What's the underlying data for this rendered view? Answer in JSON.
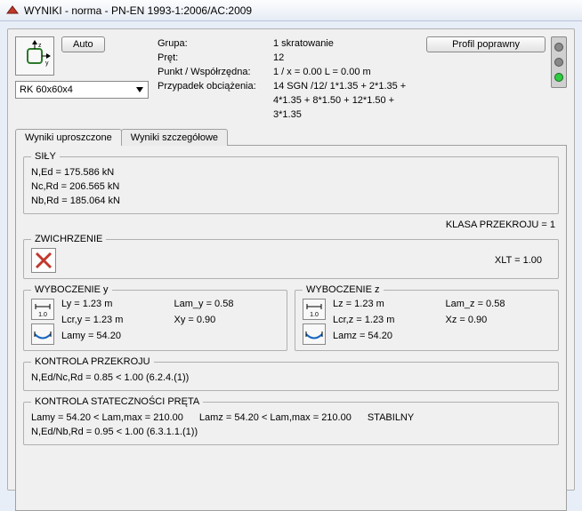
{
  "window": {
    "title": "WYNIKI - norma - PN-EN 1993-1:2006/AC:2009"
  },
  "top": {
    "auto_label": "Auto",
    "combo_value": "RK 60x60x4",
    "info": {
      "grupa_label": "Grupa:",
      "grupa_value": "1   skratowanie",
      "pret_label": "Pręt:",
      "pret_value": "12",
      "punkt_label": "Punkt / Współrzędna:",
      "punkt_value": "1 / x = 0.00 L = 0.00 m",
      "przypadek_label": "Przypadek obciążenia:",
      "przypadek_value": "14 SGN /12/  1*1.35 + 2*1.35 + 4*1.35 + 8*1.50 + 12*1.50 + 3*1.35"
    },
    "profile_status_label": "Profil poprawny"
  },
  "tabs": {
    "tab1": "Wyniki uproszczone",
    "tab2": "Wyniki szczegółowe"
  },
  "sily": {
    "legend": "SIŁY",
    "l1": "N,Ed = 175.586 kN",
    "l2": "Nc,Rd = 206.565 kN",
    "l3": "Nb,Rd = 185.064 kN"
  },
  "klasa": "KLASA PRZEKROJU = 1",
  "zwich": {
    "legend": "ZWICHRZENIE",
    "xlt": "XLT = 1.00"
  },
  "wyb_y": {
    "legend": "WYBOCZENIE  y",
    "ly": "Ly = 1.23 m",
    "lamy": "Lam_y = 0.58",
    "lcr": "Lcr,y = 1.23 m",
    "xy": "Xy = 0.90",
    "lamy2": "Lamy = 54.20"
  },
  "wyb_z": {
    "legend": "WYBOCZENIE  z",
    "lz": "Lz = 1.23 m",
    "lamz": "Lam_z = 0.58",
    "lcr": "Lcr,z = 1.23 m",
    "xz": "Xz = 0.90",
    "lamz2": "Lamz = 54.20"
  },
  "kontrola_p": {
    "legend": "KONTROLA PRZEKROJU",
    "l1": "N,Ed/Nc,Rd = 0.85 < 1.00   (6.2.4.(1))"
  },
  "kontrola_s": {
    "legend": "KONTROLA STATECZNOŚCI PRĘTA",
    "c1": "Lamy = 54.20 < Lam,max = 210.00",
    "c2": "Lamz = 54.20 < Lam,max = 210.00",
    "c3": "STABILNY",
    "l2": "N,Ed/Nb,Rd = 0.95 < 1.00   (6.3.1.1.(1))"
  },
  "icons": {
    "len_label": "1.0"
  }
}
